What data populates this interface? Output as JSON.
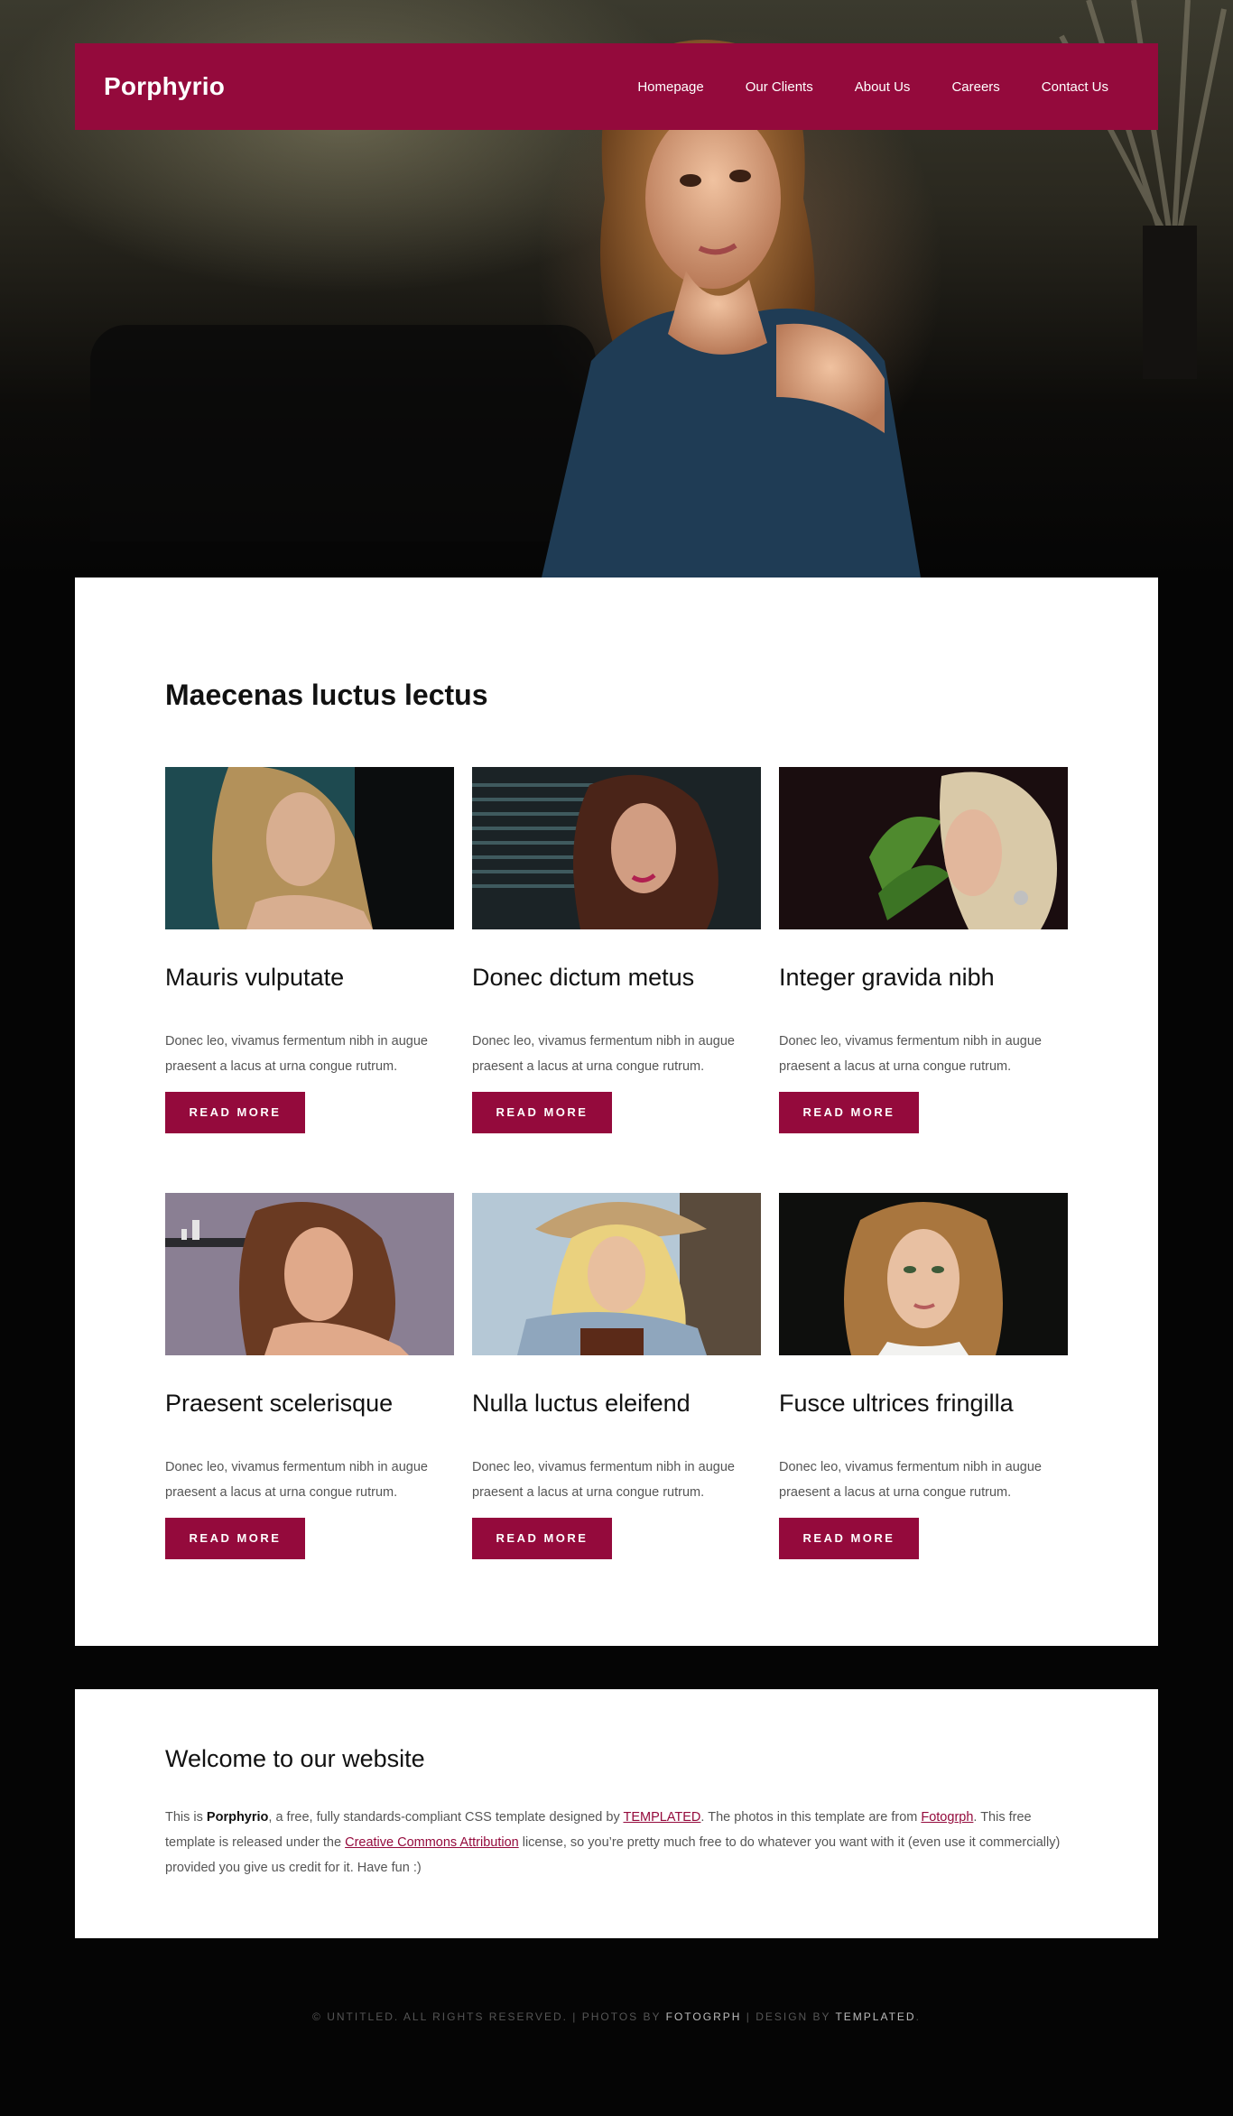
{
  "header": {
    "logo": "Porphyrio",
    "nav": [
      "Homepage",
      "Our Clients",
      "About Us",
      "Careers",
      "Contact Us"
    ]
  },
  "main": {
    "title": "Maecenas luctus lectus",
    "cards": [
      {
        "title": "Mauris vulputate",
        "text": "Donec leo, vivamus fermentum nibh in augue praesent a lacus at urna congue rutrum.",
        "button": "READ MORE"
      },
      {
        "title": "Donec dictum metus",
        "text": "Donec leo, vivamus fermentum nibh in augue praesent a lacus at urna congue rutrum.",
        "button": "READ MORE"
      },
      {
        "title": "Integer gravida nibh",
        "text": "Donec leo, vivamus fermentum nibh in augue praesent a lacus at urna congue rutrum.",
        "button": "READ MORE"
      },
      {
        "title": "Praesent scelerisque",
        "text": "Donec leo, vivamus fermentum nibh in augue praesent a lacus at urna congue rutrum.",
        "button": "READ MORE"
      },
      {
        "title": "Nulla luctus eleifend",
        "text": "Donec leo, vivamus fermentum nibh in augue praesent a lacus at urna congue rutrum.",
        "button": "READ MORE"
      },
      {
        "title": "Fusce ultrices fringilla",
        "text": "Donec leo, vivamus fermentum nibh in augue praesent a lacus at urna congue rutrum.",
        "button": "READ MORE"
      }
    ]
  },
  "welcome": {
    "title": "Welcome to our website",
    "t1": "This is ",
    "brand": "Porphyrio",
    "t2": ", a free, fully standards-compliant CSS template designed by ",
    "link1": "TEMPLATED",
    "t3": ". The photos in this template are from ",
    "link2": "Fotogrph",
    "t4": ". This free template is released under the ",
    "link3": "Creative Commons Attribution",
    "t5": " license, so you’re pretty much free to do whatever you want with it (even use it commercially) provided you give us credit for it. Have fun :)"
  },
  "footer": {
    "copy": "© UNTITLED. ALL RIGHTS RESERVED. | PHOTOS BY ",
    "photos": "FOTOGRPH",
    "sep": " | DESIGN BY ",
    "design": "TEMPLATED",
    "end": "."
  },
  "colors": {
    "accent": "#940a3c",
    "background": "#050505",
    "panel": "#ffffff"
  }
}
